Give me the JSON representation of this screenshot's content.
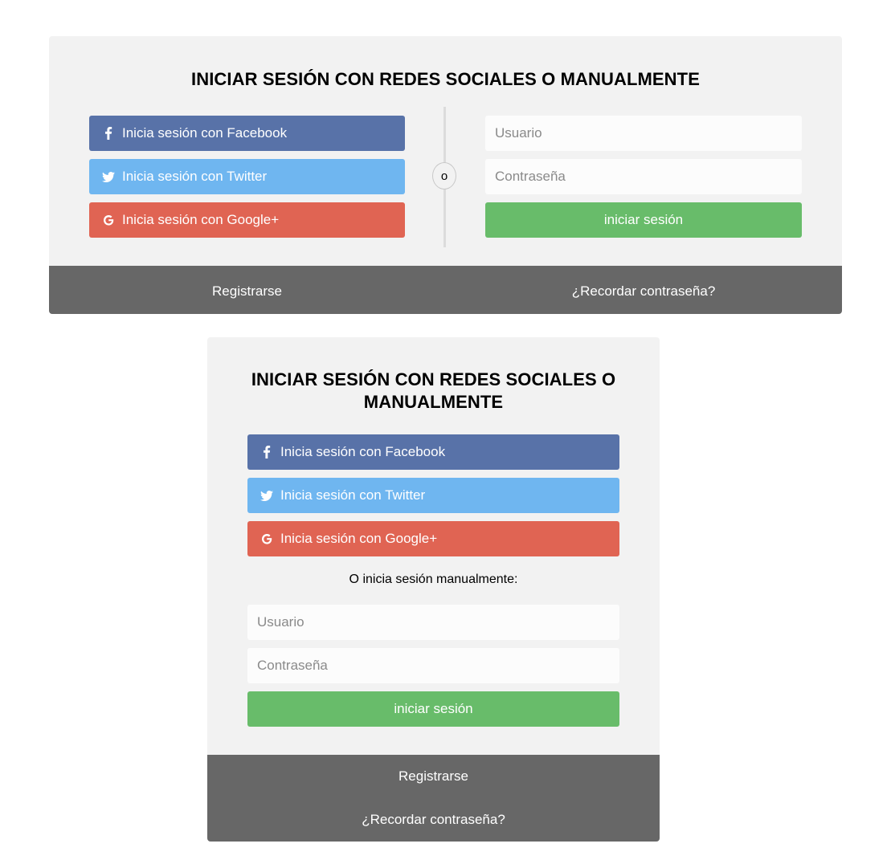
{
  "wide": {
    "title": "INICIAR SESIÓN CON REDES SOCIALES O MANUALMENTE",
    "facebook": "Inicia sesión con Facebook",
    "twitter": "Inicia sesión con Twitter",
    "google": "Inicia sesión con Google+",
    "divider": "o",
    "username_placeholder": "Usuario",
    "password_placeholder": "Contraseña",
    "submit": "iniciar sesión",
    "register": "Registrarse",
    "forgot": "¿Recordar contraseña?"
  },
  "narrow": {
    "title": "INICIAR SESIÓN CON REDES SOCIALES O MANUALMENTE",
    "facebook": "Inicia sesión con Facebook",
    "twitter": "Inicia sesión con Twitter",
    "google": "Inicia sesión con Google+",
    "manual_text": "O inicia sesión manualmente:",
    "username_placeholder": "Usuario",
    "password_placeholder": "Contraseña",
    "submit": "iniciar sesión",
    "register": "Registrarse",
    "forgot": "¿Recordar contraseña?"
  },
  "icons": {
    "facebook": "facebook-icon",
    "twitter": "twitter-icon",
    "google": "google-icon"
  },
  "colors": {
    "card_bg": "#f2f2f2",
    "facebook": "#5872a8",
    "twitter": "#6fb6f0",
    "google": "#e06453",
    "submit": "#68bc6a",
    "footer": "#676767"
  }
}
